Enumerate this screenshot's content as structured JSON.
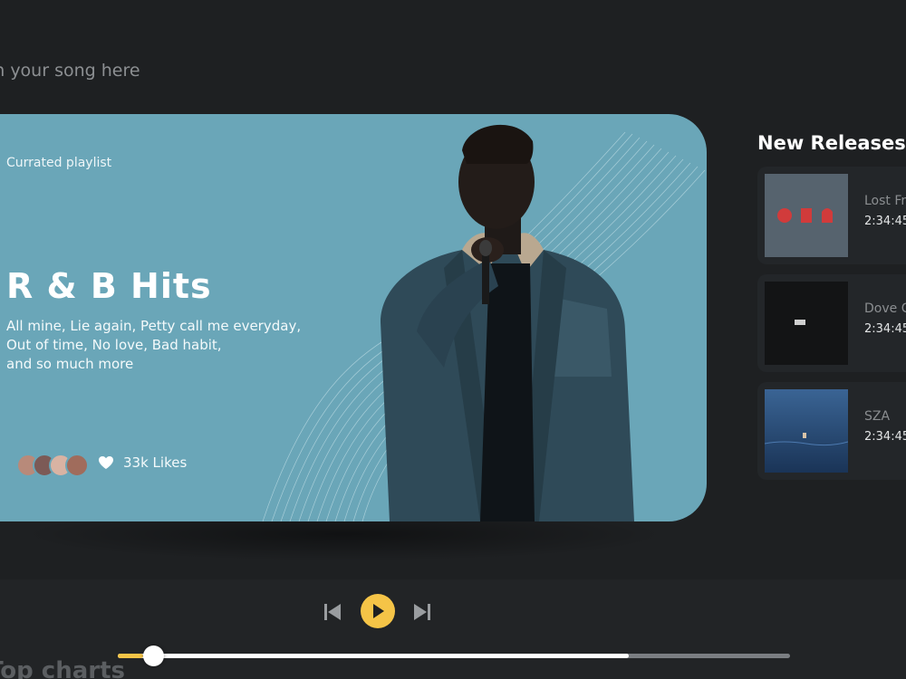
{
  "search": {
    "placeholder": "Search your song here"
  },
  "hero": {
    "label": "Currated playlist",
    "title": "R & B Hits",
    "description": [
      "All mine, Lie again, Petty call me everyday,",
      "Out of time, No love, Bad habit,",
      "and so much more"
    ],
    "likes": "33k Likes",
    "heart_icon": "heart-icon",
    "avatar_colors": [
      "#b88a7a",
      "#7c5a56",
      "#d9b3a3",
      "#a06c5c",
      "#c9a18e"
    ]
  },
  "new_releases": {
    "title": "New Releases",
    "items": [
      {
        "name": "Lost Fr",
        "time": "2:34:45"
      },
      {
        "name": "Dove C",
        "time": "2:34:45"
      },
      {
        "name": "SZA",
        "time": "2:34:45"
      }
    ]
  },
  "player": {
    "prev_icon": "skip-previous-icon",
    "play_icon": "play-icon",
    "next_icon": "skip-next-icon",
    "progress": 0.76,
    "thumb_position": 0.04,
    "accent_color": "#f5c447"
  },
  "section": {
    "charts_title": "Top charts"
  }
}
